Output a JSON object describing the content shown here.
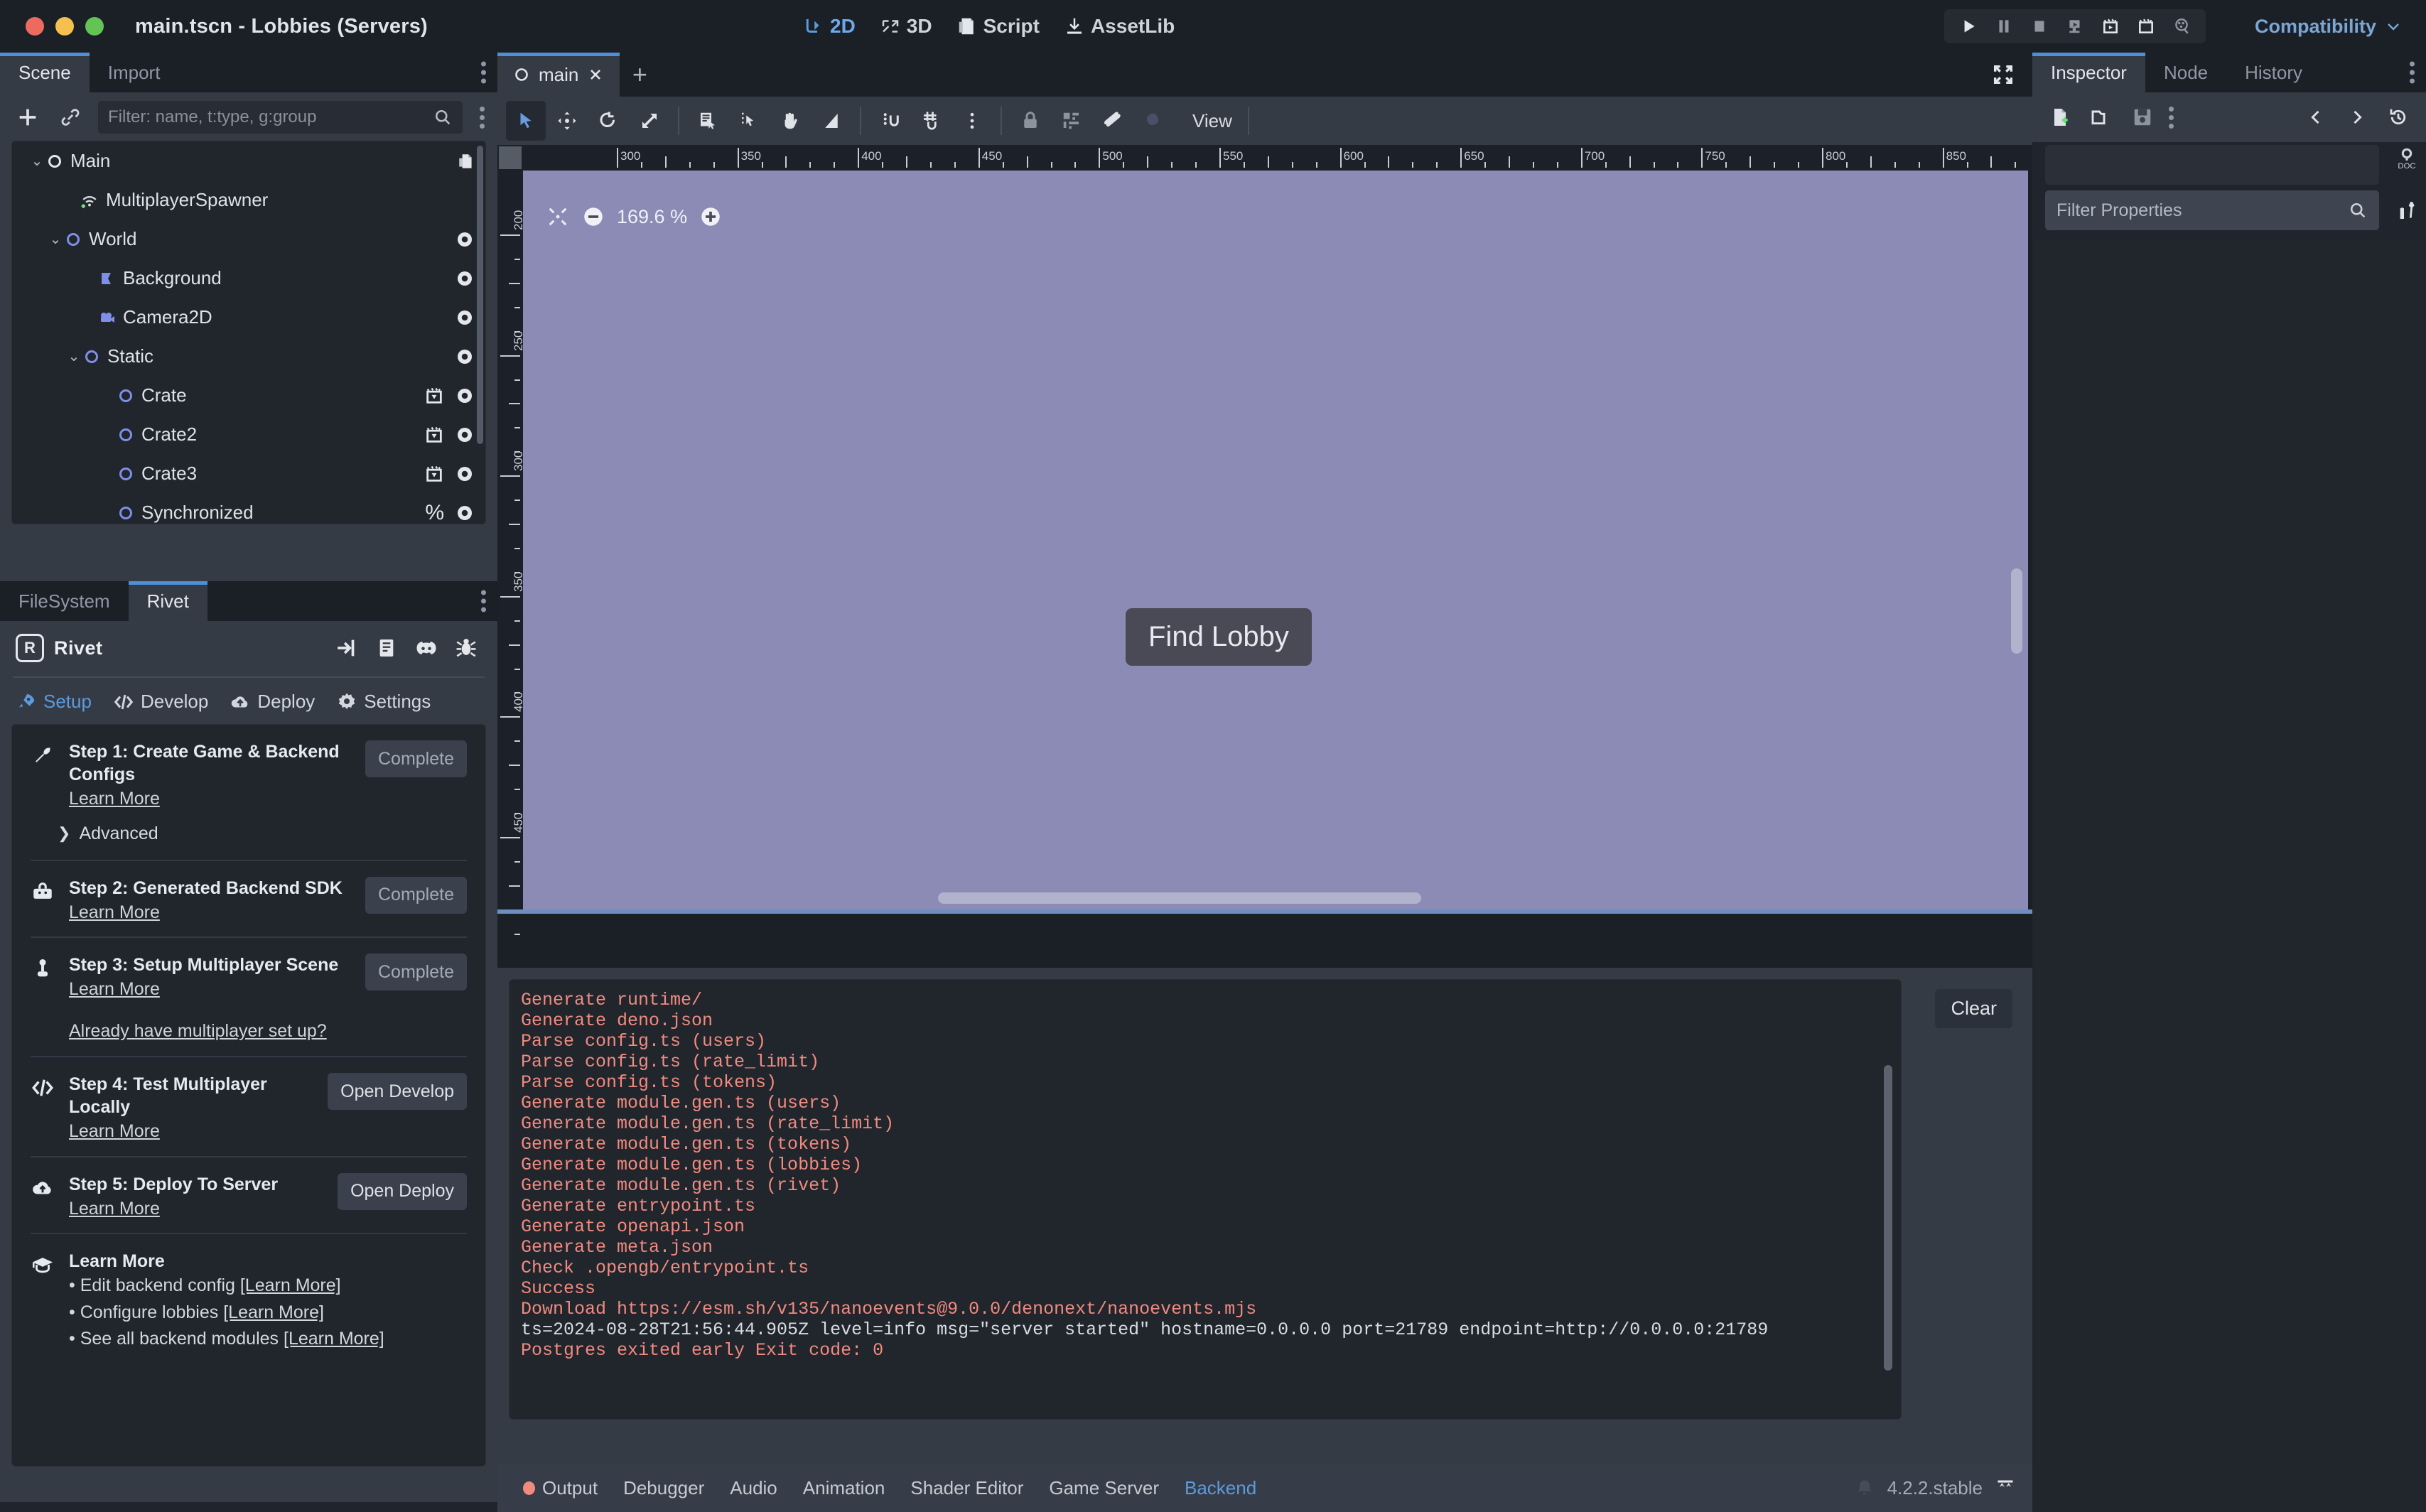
{
  "window": {
    "title": "main.tscn - Lobbies (Servers)",
    "traffic_lights": [
      "close",
      "minimize",
      "maximize"
    ]
  },
  "top_tabs": [
    {
      "label": "2D",
      "icon": "2d-icon",
      "active": true
    },
    {
      "label": "3D",
      "icon": "3d-icon",
      "active": false
    },
    {
      "label": "Script",
      "icon": "script-icon",
      "active": false
    },
    {
      "label": "AssetLib",
      "icon": "assetlib-icon",
      "active": false
    }
  ],
  "play_controls": [
    {
      "name": "run-project-button",
      "icon": "play-icon"
    },
    {
      "name": "pause-button",
      "icon": "pause-icon"
    },
    {
      "name": "stop-button",
      "icon": "stop-icon"
    },
    {
      "name": "remote-debug-button",
      "icon": "remote-debug-icon"
    },
    {
      "name": "play-scene-button",
      "icon": "play-scene-icon"
    },
    {
      "name": "play-custom-scene-button",
      "icon": "play-custom-icon"
    },
    {
      "name": "movie-maker-button",
      "icon": "movie-maker-icon"
    }
  ],
  "renderer": {
    "label": "Compatibility",
    "chevron": "chevron-down-icon"
  },
  "scene_dock": {
    "tabs": [
      {
        "label": "Scene",
        "active": true
      },
      {
        "label": "Import",
        "active": false
      }
    ],
    "filter_placeholder": "Filter: name, t:type, g:group",
    "buttons": {
      "add": "add-node-button",
      "link": "instance-child-scene-button",
      "search": "search-icon",
      "more": "more-options-button"
    },
    "tree": [
      {
        "name": "Main",
        "depth": 0,
        "icon": "node2d-icon",
        "expanded": true,
        "script": true,
        "visibility": false,
        "badge": ""
      },
      {
        "name": "MultiplayerSpawner",
        "depth": 1,
        "icon": "multiplayer-spawner-icon",
        "expanded": null,
        "script": false,
        "visibility": false,
        "badge": ""
      },
      {
        "name": "World",
        "depth": 1,
        "icon": "node2d-icon",
        "expanded": true,
        "script": false,
        "visibility": true,
        "badge": ""
      },
      {
        "name": "Background",
        "depth": 2,
        "icon": "polygon2d-icon",
        "expanded": null,
        "script": false,
        "visibility": true,
        "badge": ""
      },
      {
        "name": "Camera2D",
        "depth": 2,
        "icon": "camera2d-icon",
        "expanded": null,
        "script": false,
        "visibility": true,
        "badge": ""
      },
      {
        "name": "Static",
        "depth": 2,
        "icon": "node2d-icon",
        "expanded": true,
        "script": false,
        "visibility": true,
        "badge": ""
      },
      {
        "name": "Crate",
        "depth": 3,
        "icon": "node2d-icon",
        "expanded": null,
        "script": false,
        "visibility": true,
        "badge": "instance"
      },
      {
        "name": "Crate2",
        "depth": 3,
        "icon": "node2d-icon",
        "expanded": null,
        "script": false,
        "visibility": true,
        "badge": "instance"
      },
      {
        "name": "Crate3",
        "depth": 3,
        "icon": "node2d-icon",
        "expanded": null,
        "script": false,
        "visibility": true,
        "badge": "instance"
      },
      {
        "name": "Synchronized",
        "depth": 3,
        "icon": "node2d-icon",
        "expanded": null,
        "script": false,
        "visibility": true,
        "badge": "%"
      }
    ]
  },
  "bottom_left_dock": {
    "tabs": [
      {
        "label": "FileSystem",
        "active": false
      },
      {
        "label": "Rivet",
        "active": true
      }
    ]
  },
  "rivet": {
    "brand": "Rivet",
    "logo": "rivet-logo-icon",
    "header_icons": [
      {
        "name": "sign-in-icon"
      },
      {
        "name": "docs-icon"
      },
      {
        "name": "discord-icon"
      },
      {
        "name": "bug-icon"
      }
    ],
    "nav": [
      {
        "label": "Setup",
        "icon": "rocket-icon",
        "active": true
      },
      {
        "label": "Develop",
        "icon": "code-icon",
        "active": false
      },
      {
        "label": "Deploy",
        "icon": "cloud-upload-icon",
        "active": false
      },
      {
        "label": "Settings",
        "icon": "gear-icon",
        "active": false
      }
    ],
    "steps": [
      {
        "icon": "wrench-icon",
        "title": "Step 1: Create Game & Backend Configs",
        "link": "Learn More",
        "button": "Complete",
        "button_state": "disabled",
        "extra_link": "",
        "advanced": "Advanced"
      },
      {
        "icon": "toolbox-icon",
        "title": "Step 2: Generated Backend SDK",
        "link": "Learn More",
        "button": "Complete",
        "button_state": "disabled",
        "extra_link": ""
      },
      {
        "icon": "joystick-icon",
        "title": "Step 3: Setup Multiplayer Scene",
        "link": "Learn More",
        "button": "Complete",
        "button_state": "disabled",
        "extra_link": "Already have multiplayer set up?"
      },
      {
        "icon": "code-icon",
        "title": "Step 4: Test Multiplayer Locally",
        "link": "Learn More",
        "button": "Open Develop",
        "button_state": "action",
        "extra_link": ""
      },
      {
        "icon": "cloud-upload-icon",
        "title": "Step 5: Deploy To Server",
        "link": "Learn More",
        "button": "Open Deploy",
        "button_state": "action",
        "extra_link": ""
      }
    ],
    "learn_more": {
      "icon": "graduation-cap-icon",
      "title": "Learn More",
      "bullets": [
        {
          "text": "• Edit backend config ",
          "link": "[Learn More]"
        },
        {
          "text": "• Configure lobbies ",
          "link": "[Learn More]"
        },
        {
          "text": "• See all backend modules ",
          "link": "[Learn More]"
        }
      ]
    }
  },
  "viewport": {
    "tab": {
      "label": "main",
      "icon": "node2d-icon",
      "close": "close-icon"
    },
    "add_tab": "+",
    "expand": "expand-icon",
    "tools": [
      {
        "name": "select-mode-tool",
        "icon": "cursor-icon",
        "selected": true
      },
      {
        "name": "move-mode-tool",
        "icon": "move-icon",
        "selected": false
      },
      {
        "name": "rotate-mode-tool",
        "icon": "rotate-icon",
        "selected": false
      },
      {
        "name": "scale-mode-tool",
        "icon": "scale-icon",
        "selected": false
      },
      {
        "name": "list-select-tool",
        "icon": "list-select-icon",
        "selected": false
      },
      {
        "name": "click-select-tool",
        "icon": "click-select-icon",
        "selected": false
      },
      {
        "name": "pan-mode-tool",
        "icon": "hand-icon",
        "selected": false
      },
      {
        "name": "ruler-mode-tool",
        "icon": "ruler-icon",
        "selected": false
      },
      {
        "name": "smart-snap-tool",
        "icon": "smart-snap-icon",
        "selected": false
      },
      {
        "name": "grid-snap-tool",
        "icon": "grid-snap-icon",
        "selected": false
      },
      {
        "name": "snap-options-tool",
        "icon": "kebab-icon",
        "selected": false
      },
      {
        "name": "lock-tool",
        "icon": "lock-icon",
        "selected": false
      },
      {
        "name": "group-tool",
        "icon": "group-icon",
        "selected": false
      },
      {
        "name": "skeleton-tool",
        "icon": "bone-icon",
        "selected": false
      },
      {
        "name": "animation-key-tool",
        "icon": "key-icon",
        "selected": false
      }
    ],
    "view_menu": "View",
    "zoom": {
      "value": "169.6 %",
      "minus": "zoom-out-icon",
      "plus": "zoom-in-icon",
      "reset": "zoom-reset-icon"
    },
    "ruler_h_ticks": [
      "300",
      "350",
      "400",
      "450",
      "500",
      "550",
      "600",
      "650",
      "700",
      "750",
      "800",
      "850"
    ],
    "ruler_v_ticks": [
      "200",
      "250",
      "300",
      "350",
      "400",
      "450"
    ],
    "canvas_color": "#8c8bb5",
    "find_lobby_button": "Find Lobby"
  },
  "output": {
    "clear_label": "Clear",
    "lines": [
      {
        "text": "Generate runtime/",
        "kind": "err"
      },
      {
        "text": "Generate deno.json",
        "kind": "err"
      },
      {
        "text": "Parse config.ts (users)",
        "kind": "err"
      },
      {
        "text": "Parse config.ts (rate_limit)",
        "kind": "err"
      },
      {
        "text": "Parse config.ts (tokens)",
        "kind": "err"
      },
      {
        "text": "Generate module.gen.ts (users)",
        "kind": "err"
      },
      {
        "text": "Generate module.gen.ts (rate_limit)",
        "kind": "err"
      },
      {
        "text": "Generate module.gen.ts (tokens)",
        "kind": "err"
      },
      {
        "text": "Generate module.gen.ts (lobbies)",
        "kind": "err"
      },
      {
        "text": "Generate module.gen.ts (rivet)",
        "kind": "err"
      },
      {
        "text": "Generate entrypoint.ts",
        "kind": "err"
      },
      {
        "text": "Generate openapi.json",
        "kind": "err"
      },
      {
        "text": "Generate meta.json",
        "kind": "err"
      },
      {
        "text": "Check .opengb/entrypoint.ts",
        "kind": "err"
      },
      {
        "text": "Success",
        "kind": "err"
      },
      {
        "text": "Download https://esm.sh/v135/nanoevents@9.0.0/denonext/nanoevents.mjs",
        "kind": "err"
      },
      {
        "text": "ts=2024-08-28T21:56:44.905Z level=info msg=\"server started\" hostname=0.0.0.0 port=21789 endpoint=http://0.0.0.0:21789",
        "kind": "info"
      },
      {
        "text": "Postgres exited early Exit code: 0",
        "kind": "err"
      }
    ]
  },
  "bottom_panel": {
    "tabs": [
      {
        "label": "Output",
        "active": false,
        "dot": true
      },
      {
        "label": "Debugger",
        "active": false,
        "dot": false
      },
      {
        "label": "Audio",
        "active": false,
        "dot": false
      },
      {
        "label": "Animation",
        "active": false,
        "dot": false
      },
      {
        "label": "Shader Editor",
        "active": false,
        "dot": false
      },
      {
        "label": "Game Server",
        "active": false,
        "dot": false
      },
      {
        "label": "Backend",
        "active": true,
        "dot": false
      }
    ],
    "version": "4.2.2.stable",
    "bell": "bell-icon",
    "expand": "expand-bottom-icon"
  },
  "inspector": {
    "tabs": [
      {
        "label": "Inspector",
        "active": true
      },
      {
        "label": "Node",
        "active": false
      },
      {
        "label": "History",
        "active": false
      }
    ],
    "toolbar": [
      {
        "name": "new-resource-button",
        "icon": "new-file-icon"
      },
      {
        "name": "load-resource-button",
        "icon": "folder-icon"
      },
      {
        "name": "save-resource-button",
        "icon": "save-icon"
      },
      {
        "name": "resource-options-button",
        "icon": "kebab-icon"
      },
      {
        "name": "history-back-button",
        "icon": "chevron-left-icon"
      },
      {
        "name": "history-forward-button",
        "icon": "chevron-right-icon"
      },
      {
        "name": "history-button",
        "icon": "history-icon"
      }
    ],
    "filter_placeholder": "Filter Properties",
    "side_icons": [
      {
        "name": "open-docs-button",
        "icon": "doc-search-icon"
      },
      {
        "name": "object-tools-button",
        "icon": "tools-icon"
      }
    ],
    "kebab": "more-options-button"
  },
  "colors": {
    "accent": "#4d90d8",
    "link": "#5b9bde",
    "error_text": "#f18b80",
    "canvas": "#8c8bb5",
    "panel": "#353b45",
    "panel_dark": "#21252c",
    "window_bg": "#1b1f26"
  }
}
